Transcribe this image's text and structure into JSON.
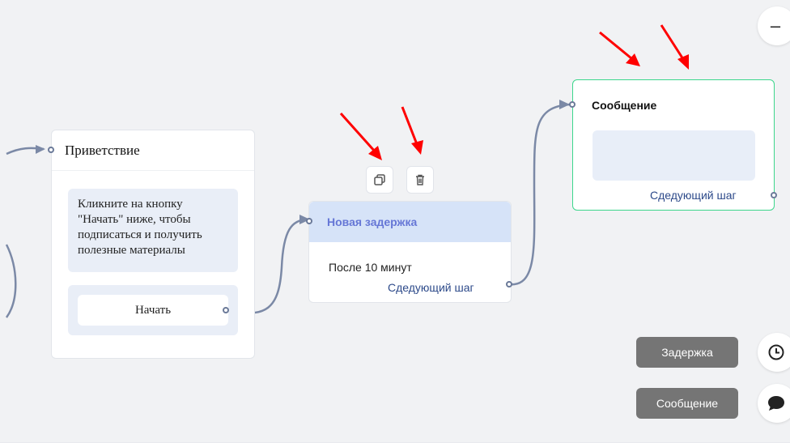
{
  "colors": {
    "canvas": "#f1f2f4",
    "wire": "#7b89a6",
    "accent_header": "#d6e3f8",
    "accent_title": "#6677d6",
    "selected_border": "#3dd68c",
    "arrow": "#ff0000",
    "pill": "#757575"
  },
  "nodes": {
    "welcome": {
      "title": "Приветствие",
      "text": "Кликните на кнопку \"Начать\" ниже, чтобы подписаться и получить полезные материалы",
      "button_label": "Начать"
    },
    "delay": {
      "title": "Новая задержка",
      "body": "После 10 минут",
      "next_label": "Сдедующий шаг"
    },
    "message": {
      "title": "Сообщение",
      "next_label": "Сдедующий шаг"
    }
  },
  "node_actions": {
    "icons": [
      "copy-icon",
      "trash-icon"
    ]
  },
  "zoom": {
    "label": "–"
  },
  "add_panel": {
    "delay_label": "Задержка",
    "message_label": "Сообщение",
    "icons": [
      "clock-icon",
      "chat-bubble-icon"
    ]
  }
}
